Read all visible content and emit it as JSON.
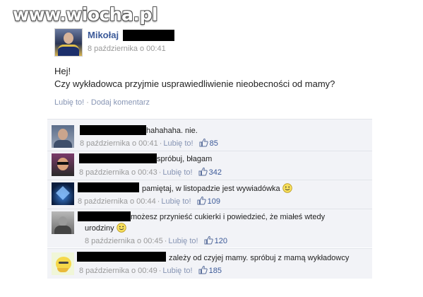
{
  "watermark": "www.wiocha.pl",
  "post": {
    "author_first": "Mikołaj",
    "date": "8 października o 00:41",
    "text_line1": "Hej!",
    "text_line2": "Czy wykładowca przyjmie usprawiedliwienie nieobecności od mamy?",
    "like_link": "Lubię to!",
    "separator": "·",
    "comment_link": "Dodaj komentarz"
  },
  "comments": [
    {
      "text": "hahahaha. nie.",
      "date": "8 października o 00:41",
      "like_link": "Lubię to!",
      "likes": "85"
    },
    {
      "text": "spróbuj, błagam",
      "date": "8 października o 00:43",
      "like_link": "Lubię to!",
      "likes": "342"
    },
    {
      "text": "pamiętaj, w listopadzie jest wywiadówka",
      "date": "8 października o 00:44",
      "like_link": "Lubię to!",
      "likes": "109"
    },
    {
      "text_line1": "możesz przynieść cukierki i powiedzieć, że miałeś wtedy",
      "text_line2": "urodziny",
      "date": "8 października o 00:45",
      "like_link": "Lubię to!",
      "likes": "120"
    },
    {
      "text": "zależy od czyjej mamy. spróbuj z mamą wykładowcy",
      "date": "8 października o 00:49",
      "like_link": "Lubię to!",
      "likes": "185"
    }
  ],
  "meta_separator": "·",
  "colors": {
    "link": "#3b5998",
    "muted": "#999999",
    "comment_bg": "#f2f3f7",
    "redaction": "#000000"
  },
  "icons": [
    "thumbs-up-icon",
    "smiley-icon"
  ]
}
